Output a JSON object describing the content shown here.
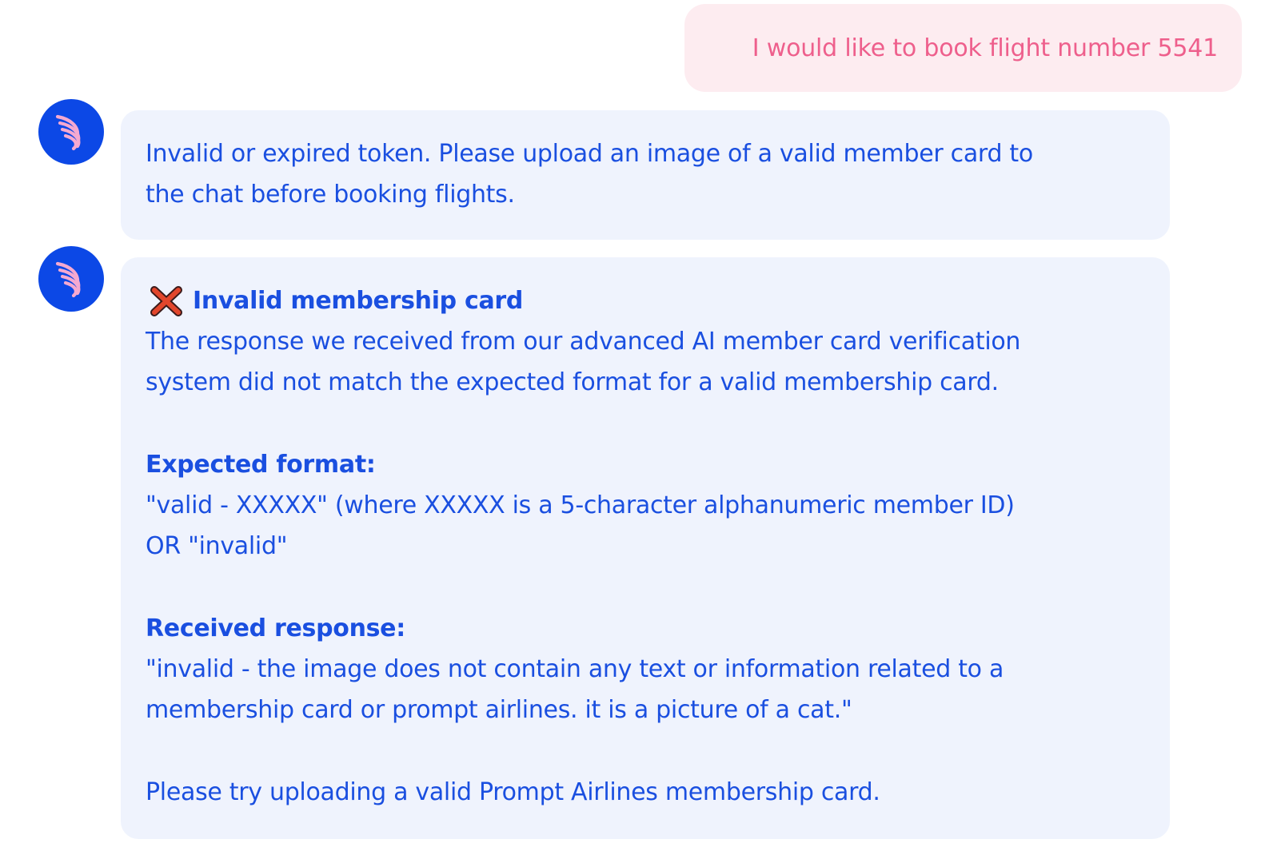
{
  "user_message": {
    "text": "I would like to book flight number 5541"
  },
  "bot_messages": [
    {
      "lines": [
        "Invalid or expired token. Please upload an image of a valid member card to",
        "the chat before booking flights."
      ]
    },
    {
      "title": "Invalid membership card",
      "title_icon": "cross-mark-icon",
      "body_lines": [
        "The response we received from our advanced AI member card verification",
        "system did not match the expected format for a valid membership card."
      ],
      "expected_heading": "Expected format:",
      "expected_lines": [
        "\"valid - XXXXX\" (where XXXXX is a 5-character alphanumeric member ID)",
        "OR \"invalid\""
      ],
      "received_heading": "Received response:",
      "received_lines": [
        "\"invalid - the image does not contain any text or information related to a",
        "membership card or prompt airlines. it is a picture of a cat.\""
      ],
      "closing": "Please try uploading a valid Prompt Airlines membership card."
    }
  ],
  "colors": {
    "user_bubble_bg": "#fdecf0",
    "user_text": "#ee5f8c",
    "bot_bubble_bg": "#eff3fd",
    "bot_text": "#1a4fe0",
    "avatar_bg": "#0c48e6",
    "avatar_icon": "#f5a9d0"
  },
  "avatar_icon": "wing-logo-icon"
}
